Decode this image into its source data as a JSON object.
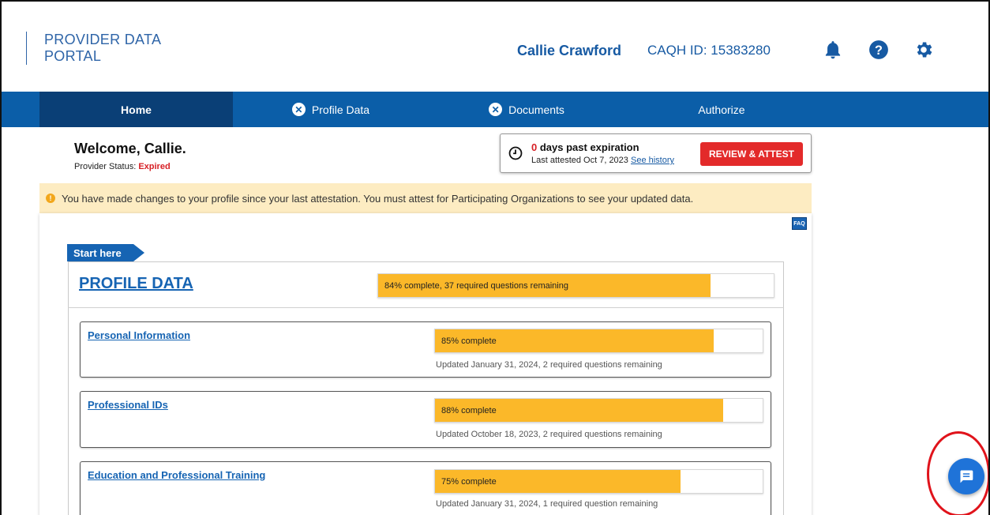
{
  "header": {
    "logo_line1": "PROVIDER DATA",
    "logo_line2": "PORTAL",
    "user_name": "Callie Crawford",
    "caqh_id": "CAQH ID: 15383280",
    "icons": [
      "bell-icon",
      "help-icon",
      "gear-icon"
    ]
  },
  "nav": {
    "items": [
      {
        "label": "Home",
        "active": true,
        "icon": ""
      },
      {
        "label": "Profile Data",
        "active": false,
        "icon": "x-circle-icon"
      },
      {
        "label": "Documents",
        "active": false,
        "icon": "x-circle-icon"
      },
      {
        "label": "Authorize",
        "active": false,
        "icon": ""
      }
    ]
  },
  "welcome": {
    "title": "Welcome, Callie.",
    "status_label": "Provider Status:",
    "status_value": "Expired"
  },
  "expiration": {
    "days": "0",
    "days_text": "days past expiration",
    "last_attested": "Last attested Oct 7, 2023",
    "history_link": "See history",
    "button": "REVIEW & ATTEST"
  },
  "alert": {
    "text": "You have made changes to your profile since your last attestation. You must attest for Participating Organizations to see your updated data."
  },
  "faq": {
    "label": "FAQ"
  },
  "start_tag": "Start here",
  "profile": {
    "title": "PROFILE DATA",
    "progress": 84,
    "progress_label": "84% complete, 37 required questions remaining"
  },
  "sections": [
    {
      "title": "Personal Information",
      "progress": 85,
      "progress_label": "85% complete",
      "updated": "Updated January 31, 2024, 2 required questions remaining"
    },
    {
      "title": "Professional IDs",
      "progress": 88,
      "progress_label": "88% complete",
      "updated": "Updated October 18, 2023, 2 required questions remaining"
    },
    {
      "title": "Education and Professional Training",
      "progress": 75,
      "progress_label": "75% complete",
      "updated": "Updated January 31, 2024, 1 required question remaining"
    }
  ],
  "colors": {
    "nav_bg": "#0b5ea8",
    "nav_active": "#0a3f76",
    "accent": "#1664b3",
    "progress": "#fbb829",
    "danger": "#e32a2a"
  }
}
